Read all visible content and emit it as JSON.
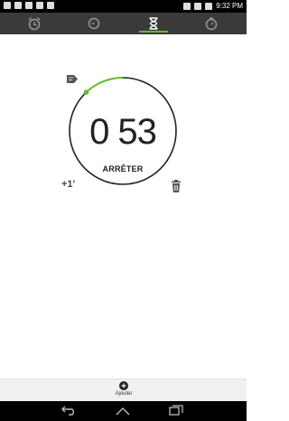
{
  "status_bar": {
    "time": "9:32 PM"
  },
  "tabs": [
    {
      "name": "alarm",
      "icon": "alarm-clock-icon"
    },
    {
      "name": "clock",
      "icon": "clock-icon"
    },
    {
      "name": "timer",
      "icon": "hourglass-icon",
      "active": true
    },
    {
      "name": "stopwatch",
      "icon": "stopwatch-icon"
    }
  ],
  "timer": {
    "time_display": "0 53",
    "stop_label": "ARRÊTER",
    "add_minute_label": "+1'",
    "progress_fraction": 0.12
  },
  "bottom": {
    "add_label": "Ajouter"
  },
  "colors": {
    "accent": "#5fbf2a",
    "tab_bar": "#3a3a3a"
  }
}
